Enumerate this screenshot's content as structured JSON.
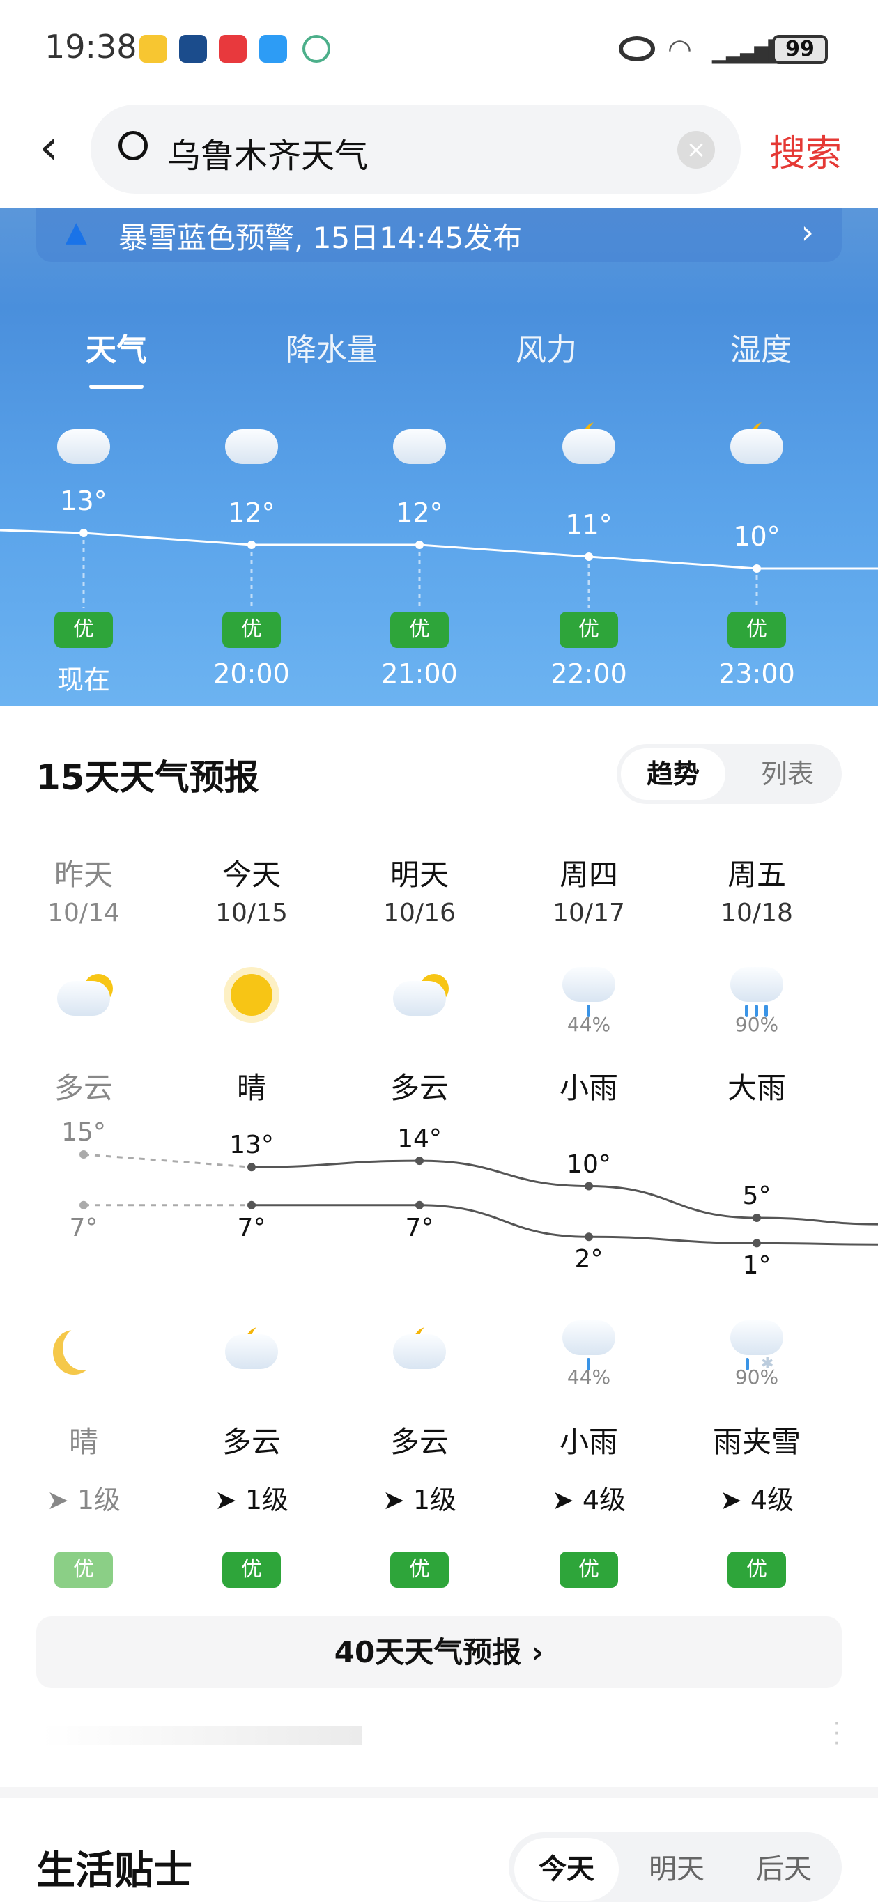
{
  "status": {
    "time": "19:38",
    "battery": "99",
    "app_icons": [
      "meituan",
      "app2",
      "huawei",
      "messages",
      "app5"
    ]
  },
  "search": {
    "value": "乌鲁木齐天气",
    "button": "搜索",
    "accent": "#e53935"
  },
  "alert": {
    "text": "暴雪蓝色预警, 15日14:45发布"
  },
  "tabs": [
    "天气",
    "降水量",
    "风力",
    "湿度"
  ],
  "hourly": [
    {
      "time": "现在",
      "temp": "13°",
      "t": 13,
      "aqi": "优",
      "icon": "cloudy"
    },
    {
      "time": "20:00",
      "temp": "12°",
      "t": 12,
      "aqi": "优",
      "icon": "cloudy"
    },
    {
      "time": "21:00",
      "temp": "12°",
      "t": 12,
      "aqi": "优",
      "icon": "cloudy"
    },
    {
      "time": "22:00",
      "temp": "11°",
      "t": 11,
      "aqi": "优",
      "icon": "cloudy-night"
    },
    {
      "time": "23:00",
      "temp": "10°",
      "t": 10,
      "aqi": "优",
      "icon": "cloudy-night"
    }
  ],
  "forecast": {
    "title": "15天天气预报",
    "toggle": [
      "趋势",
      "列表"
    ],
    "days": [
      {
        "name": "昨天",
        "date": "10/14",
        "day_icon": "partly-cloudy",
        "day_pop": "",
        "day_cond": "多云",
        "high": "15°",
        "hi": 15,
        "low": "7°",
        "lo": 7,
        "night_icon": "moon",
        "night_pop": "",
        "night_cond": "晴",
        "wind": "1级",
        "aqi": "优",
        "past": true
      },
      {
        "name": "今天",
        "date": "10/15",
        "day_icon": "sunny",
        "day_pop": "",
        "day_cond": "晴",
        "high": "13°",
        "hi": 13,
        "low": "7°",
        "lo": 7,
        "night_icon": "cloudy-night",
        "night_pop": "",
        "night_cond": "多云",
        "wind": "1级",
        "aqi": "优"
      },
      {
        "name": "明天",
        "date": "10/16",
        "day_icon": "partly-cloudy",
        "day_pop": "",
        "day_cond": "多云",
        "high": "14°",
        "hi": 14,
        "low": "7°",
        "lo": 7,
        "night_icon": "cloudy-night",
        "night_pop": "",
        "night_cond": "多云",
        "wind": "1级",
        "aqi": "优"
      },
      {
        "name": "周四",
        "date": "10/17",
        "day_icon": "light-rain",
        "day_pop": "44%",
        "day_cond": "小雨",
        "high": "10°",
        "hi": 10,
        "low": "2°",
        "lo": 2,
        "night_icon": "light-rain",
        "night_pop": "44%",
        "night_cond": "小雨",
        "wind": "4级",
        "aqi": "优"
      },
      {
        "name": "周五",
        "date": "10/18",
        "day_icon": "heavy-rain",
        "day_pop": "90%",
        "day_cond": "大雨",
        "high": "5°",
        "hi": 5,
        "low": "1°",
        "lo": 1,
        "night_icon": "sleet",
        "night_pop": "90%",
        "night_cond": "雨夹雪",
        "wind": "4级",
        "aqi": "优"
      }
    ],
    "more": "40天天气预报 ›"
  },
  "tips": {
    "title": "生活贴士",
    "tabs": [
      "今天",
      "明天",
      "后天"
    ]
  },
  "colors": {
    "aqi_good": "#2ea53a",
    "sky": "#4a8fdc"
  }
}
